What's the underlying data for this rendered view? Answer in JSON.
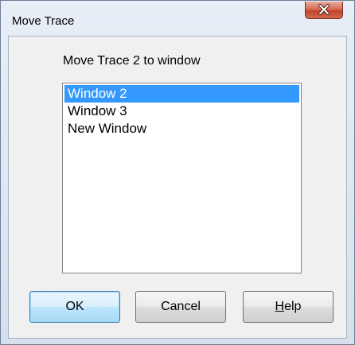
{
  "window": {
    "title": "Move Trace",
    "close_icon": "close-icon"
  },
  "dialog": {
    "prompt": "Move Trace 2 to window",
    "list": {
      "items": [
        {
          "label": "Window 2",
          "selected": true
        },
        {
          "label": "Window 3",
          "selected": false
        },
        {
          "label": "New Window",
          "selected": false
        }
      ]
    },
    "buttons": {
      "ok": "OK",
      "cancel": "Cancel",
      "help_mnemonic": "H",
      "help_rest": "elp"
    }
  },
  "colors": {
    "selection": "#3399ff",
    "close_button": "#c3432a"
  }
}
